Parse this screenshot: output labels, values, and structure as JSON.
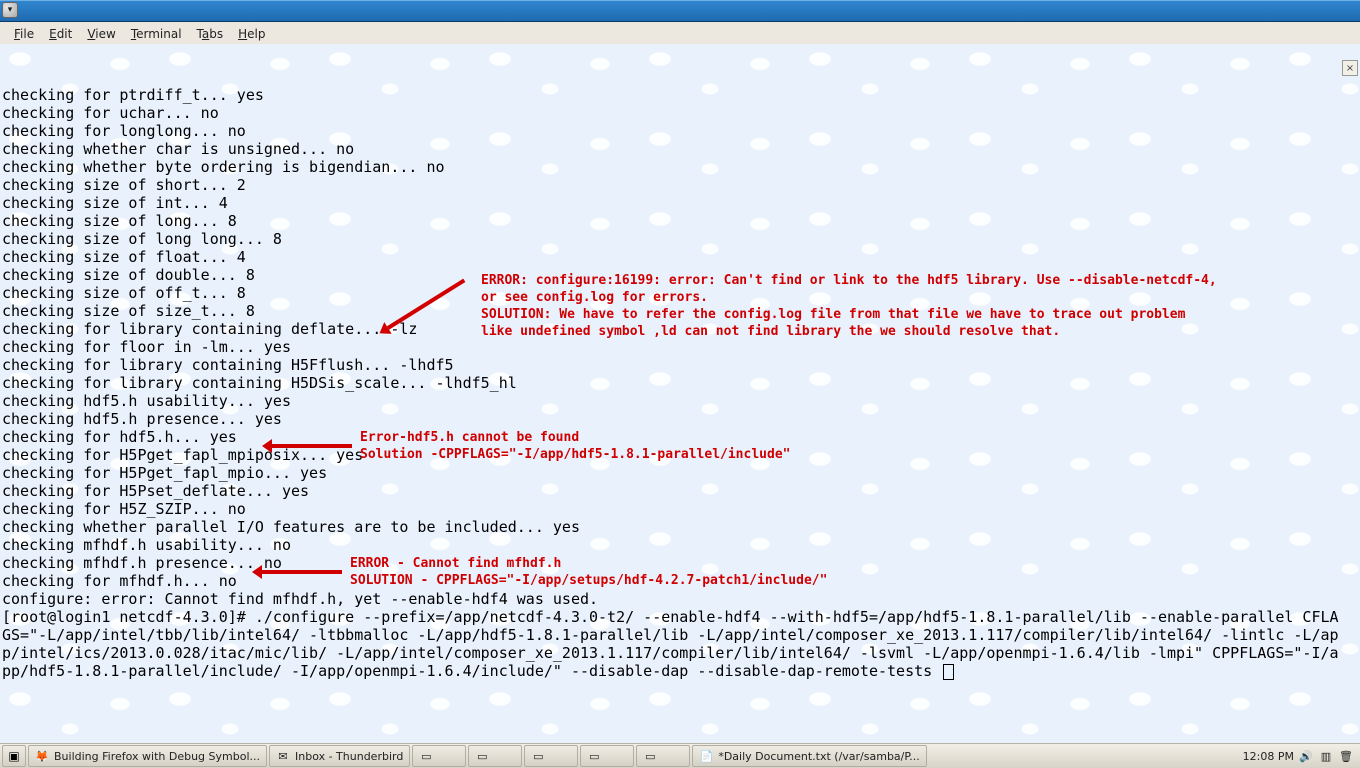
{
  "menus": {
    "file": "File",
    "edit": "Edit",
    "view": "View",
    "terminal": "Terminal",
    "tabs": "Tabs",
    "help": "Help"
  },
  "terminal_lines": [
    "checking for ptrdiff_t... yes",
    "checking for uchar... no",
    "checking for longlong... no",
    "checking whether char is unsigned... no",
    "checking whether byte ordering is bigendian... no",
    "checking size of short... 2",
    "checking size of int... 4",
    "checking size of long... 8",
    "checking size of long long... 8",
    "checking size of float... 4",
    "checking size of double... 8",
    "checking size of off_t... 8",
    "checking size of size_t... 8",
    "checking for library containing deflate... -lz",
    "checking for floor in -lm... yes",
    "checking for library containing H5Fflush... -lhdf5",
    "checking for library containing H5DSis_scale... -lhdf5_hl",
    "checking hdf5.h usability... yes",
    "checking hdf5.h presence... yes",
    "checking for hdf5.h... yes",
    "checking for H5Pget_fapl_mpiposix... yes",
    "checking for H5Pget_fapl_mpio... yes",
    "checking for H5Pset_deflate... yes",
    "checking for H5Z_SZIP... no",
    "checking whether parallel I/O features are to be included... yes",
    "checking mfhdf.h usability... no",
    "checking mfhdf.h presence... no",
    "checking for mfhdf.h... no"
  ],
  "terminal_tail": [
    "configure: error: Cannot find mfhdf.h, yet --enable-hdf4 was used.",
    "[root@login1 netcdf-4.3.0]# ./configure --prefix=/app/netcdf-4.3.0-t2/ --enable-hdf4 --with-hdf5=/app/hdf5-1.8.1-parallel/lib --enable-parallel CFLAGS=\"-L/app/intel/tbb/lib/intel64/ -ltbbmalloc -L/app/hdf5-1.8.1-parallel/lib -L/app/intel/composer_xe_2013.1.117/compiler/lib/intel64/ -lintlc -L/app/intel/ics/2013.0.028/itac/mic/lib/ -L/app/intel/composer_xe_2013.1.117/compiler/lib/intel64/ -lsvml -L/app/openmpi-1.6.4/lib -lmpi\" CPPFLAGS=\"-I/app/hdf5-1.8.1-parallel/include/ -I/app/openmpi-1.6.4/include/\" --disable-dap --disable-dap-remote-tests "
  ],
  "annos": {
    "a1": "ERROR: configure:16199: error: Can't find or link to the hdf5 library. Use --disable-netcdf-4,\nor see config.log for errors.\nSOLUTION: We have to refer the config.log file from that file we have to trace out problem\nlike undefined symbol ,ld can not find library the we should resolve that.",
    "a2": "Error-hdf5.h cannot be found\nSolution -CPPFLAGS=\"-I/app/hdf5-1.8.1-parallel/include\"",
    "a3": "ERROR - Cannot find mfhdf.h\nSOLUTION - CPPFLAGS=\"-I/app/setups/hdf-4.2.7-patch1/include/\""
  },
  "taskbar": {
    "items": [
      {
        "label": "Building Firefox with Debug Symbol...",
        "icon": "🦊"
      },
      {
        "label": "Inbox - Thunderbird",
        "icon": "✉"
      },
      {
        "label": "",
        "icon": "▭"
      },
      {
        "label": "",
        "icon": "▭"
      },
      {
        "label": "",
        "icon": "▭"
      },
      {
        "label": "",
        "icon": "▭"
      },
      {
        "label": "",
        "icon": "▭"
      },
      {
        "label": "*Daily Document.txt  (/var/samba/P...",
        "icon": "📄"
      }
    ],
    "clock": "12:08 PM"
  }
}
